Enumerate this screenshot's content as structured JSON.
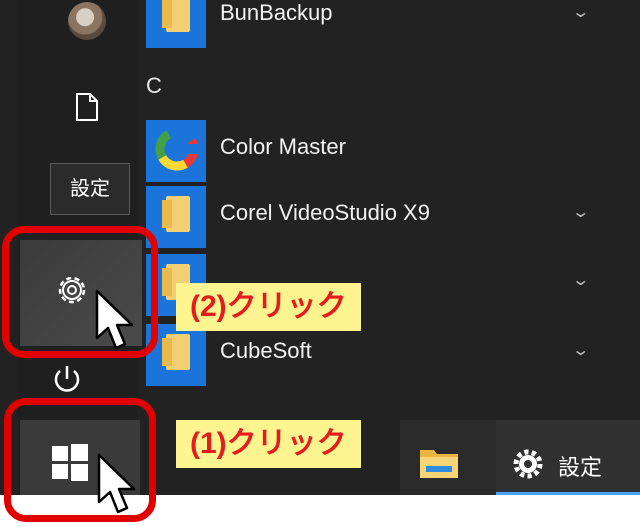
{
  "rail": {
    "avatar": "user-avatar",
    "documents_icon": "document-icon",
    "settings_icon": "gear-icon",
    "power_icon": "power-icon",
    "start_icon": "windows-logo-icon",
    "tooltip": "設定"
  },
  "app_list": {
    "items": [
      {
        "label": "BunBackup",
        "icon": "folder-icon",
        "expandable": true
      },
      {
        "label": "Color Master",
        "icon": "color-master-icon",
        "expandable": false
      },
      {
        "label": "Corel VideoStudio X9",
        "icon": "folder-icon",
        "expandable": true
      },
      {
        "label": "",
        "icon": "folder-icon",
        "expandable": true
      },
      {
        "label": "CubeSoft",
        "icon": "folder-icon",
        "expandable": true
      }
    ],
    "section_header": "C"
  },
  "taskbar": {
    "explorer_icon": "file-explorer-icon",
    "settings_label": "設定"
  },
  "callouts": {
    "step2": "(2)クリック",
    "step1": "(1)クリック"
  },
  "colors": {
    "menu_bg": "#222222",
    "tile_blue": "#1b74d9",
    "highlight_red": "#e10000",
    "callout_yellow": "#fff590",
    "callout_text": "#e31c1c"
  }
}
